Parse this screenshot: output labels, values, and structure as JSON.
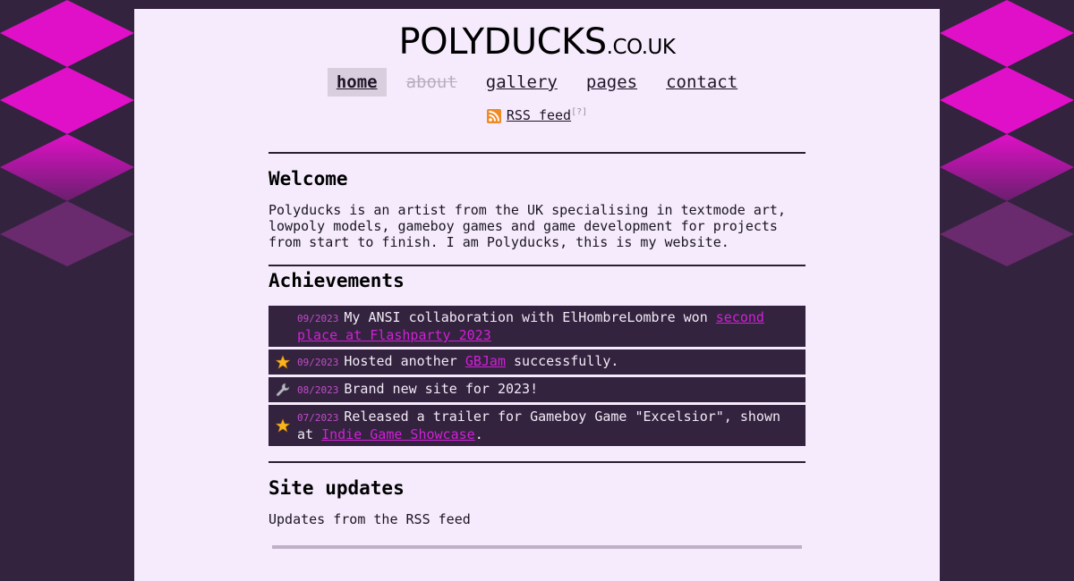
{
  "logo": {
    "main": "POLYDUCKS",
    "tld": ".CO.UK"
  },
  "nav": {
    "items": [
      {
        "label": "home",
        "state": "active"
      },
      {
        "label": "about",
        "state": "disabled"
      },
      {
        "label": "gallery",
        "state": "normal"
      },
      {
        "label": "pages",
        "state": "normal"
      },
      {
        "label": "contact",
        "state": "normal"
      }
    ]
  },
  "rss": {
    "icon": "rss-icon",
    "label": "RSS feed",
    "help": "[?]"
  },
  "welcome": {
    "heading": "Welcome",
    "text": "Polyducks is an artist from the UK specialising in textmode art, lowpoly models, gameboy games and game development for projects from start to finish. I am Polyducks, this is my website."
  },
  "achievements": {
    "heading": "Achievements",
    "items": [
      {
        "icon": "none",
        "date": "09/2023",
        "before": "My ANSI collaboration with ElHombreLombre won ",
        "link": "second place at Flashparty 2023",
        "after": ""
      },
      {
        "icon": "star-icon",
        "date": "09/2023",
        "before": "Hosted another ",
        "link": "GBJam",
        "after": " successfully."
      },
      {
        "icon": "wrench-icon",
        "date": "08/2023",
        "before": "Brand new site for 2023!",
        "link": "",
        "after": ""
      },
      {
        "icon": "star-icon",
        "date": "07/2023",
        "before": "Released a trailer for Gameboy Game \"Excelsior\", shown at ",
        "link": "Indie Game Showcase",
        "after": "."
      }
    ]
  },
  "updates": {
    "heading": "Site updates",
    "text": "Updates from the RSS feed"
  },
  "colors": {
    "background": "#33233e",
    "page": "#f6ebfc",
    "diamond": "#e010c8",
    "link": "#d021d6"
  }
}
